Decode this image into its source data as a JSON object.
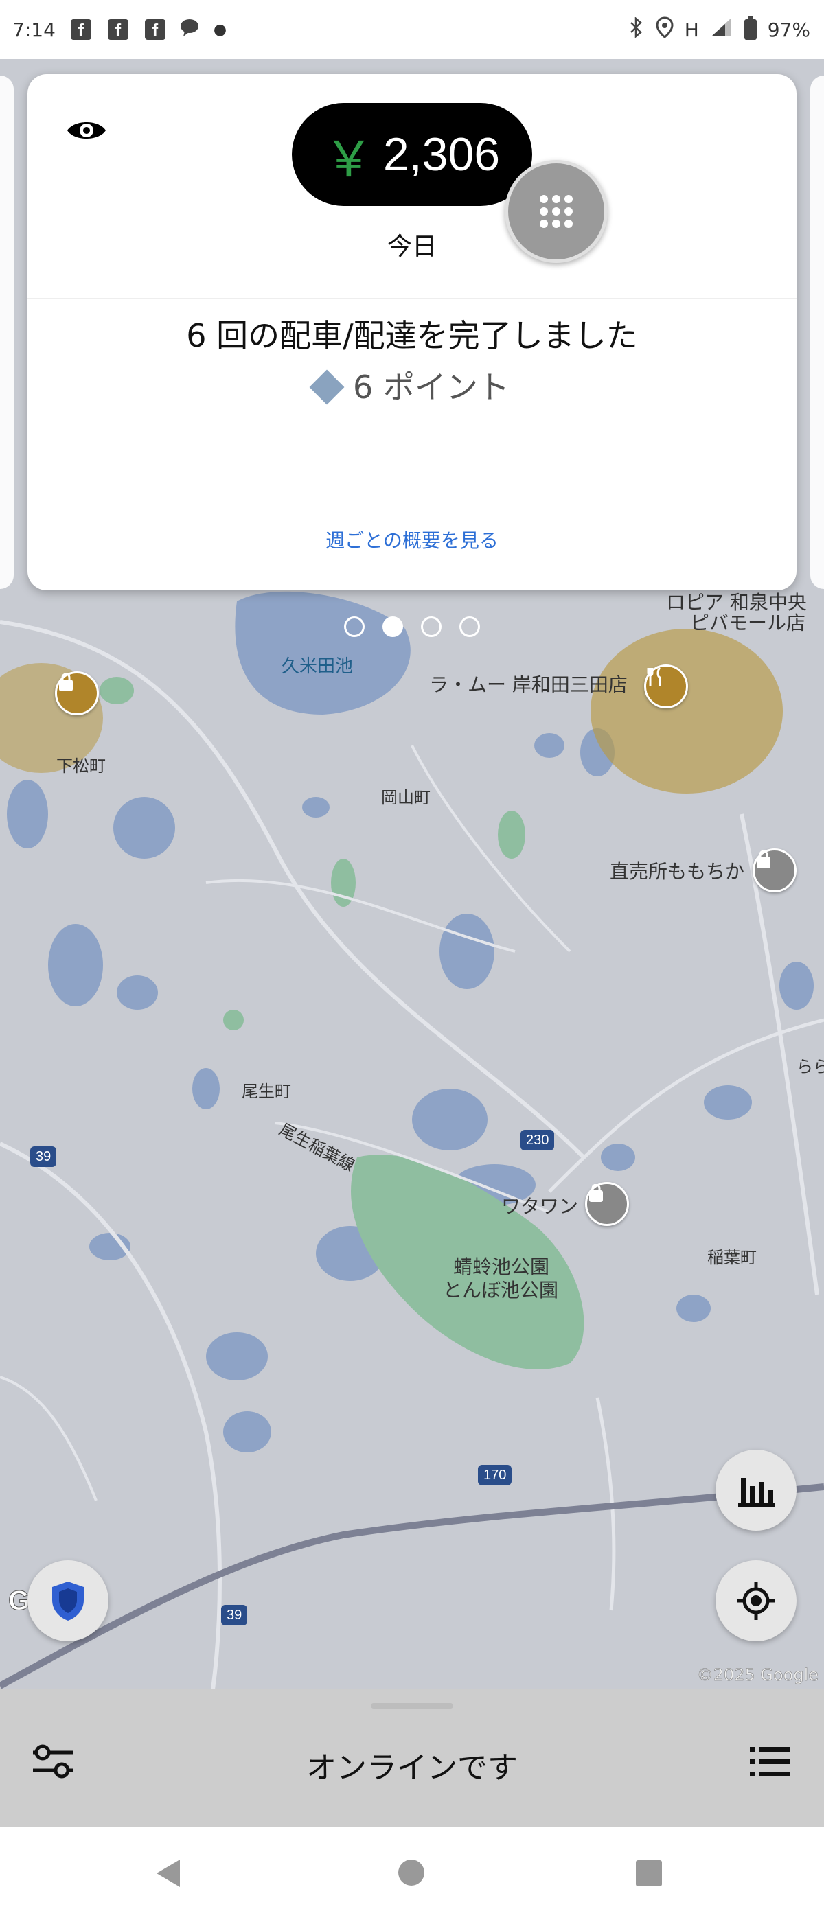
{
  "status_bar": {
    "time": "7:14",
    "network": "H",
    "battery": "97%"
  },
  "earnings_card": {
    "currency": "￥",
    "amount": "2,306",
    "period": "今日",
    "completed_text": "6 回の配車/配達を完了しました",
    "points_text": "6 ポイント",
    "weekly_link": "週ごとの概要を見る"
  },
  "carousel": {
    "pages": 4,
    "active_index": 1
  },
  "map": {
    "labels": {
      "pond": "久米田池",
      "shimomatsu": "下松町",
      "okayama": "岡山町",
      "restaurant": "ラ・ムー 岸和田三田店",
      "mall": "ロピア 和泉中央",
      "mall2": "ピバモール店",
      "farm_store": "直売所ももちか",
      "oju": "尾生町",
      "oju_line": "尾生稲葉線",
      "watawan": "ワタワン",
      "park": "蜻蛉池公園",
      "park2": "とんぼ池公園",
      "inaba": "稲葉町",
      "rara": "らら"
    },
    "route_badges": {
      "r39a": "39",
      "r230": "230",
      "r170": "170",
      "r39b": "39"
    },
    "google_logo": "Google",
    "copyright": "©2025 Google"
  },
  "bottom_sheet": {
    "status": "オンラインです"
  }
}
